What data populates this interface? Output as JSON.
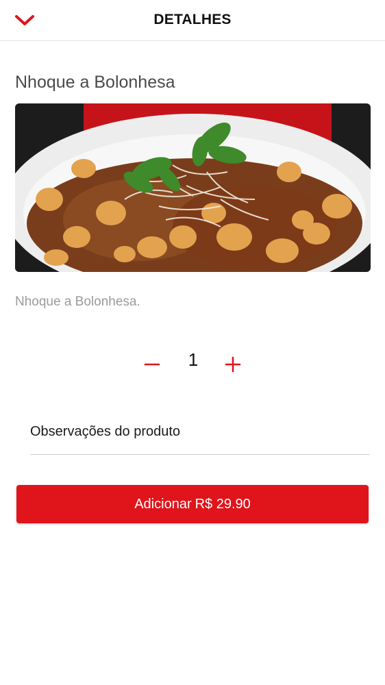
{
  "header": {
    "title": "DETALHES",
    "back_icon": "chevron-down-icon"
  },
  "product": {
    "name": "Nhoque a Bolonhesa",
    "description": "Nhoque a Bolonhesa.",
    "image_icon": "food-photo"
  },
  "quantity": {
    "value": "1",
    "minus_icon": "minus-icon",
    "plus_icon": "plus-icon"
  },
  "notes": {
    "label": "Observações do produto"
  },
  "add_button": {
    "label": "Adicionar",
    "price": "R$ 29.90"
  },
  "colors": {
    "accent": "#e0141b",
    "text_muted": "#9a9a9a",
    "divider": "#e3e3e3"
  }
}
